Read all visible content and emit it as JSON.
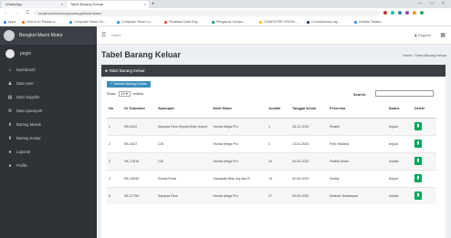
{
  "browser": {
    "tabs": [
      {
        "label": "WhatsApp",
        "close": "×"
      },
      {
        "label": "Tabel Barang Keluar",
        "close": "×"
      }
    ],
    "new_tab": "+",
    "window_controls": "— □ ×",
    "nav": "← → C ⌂",
    "url": "localhost/inventory/barang/keluar/index",
    "extension_colors": [
      "#c0392b",
      "#1abc9c",
      "#2980b9",
      "#8e44ad",
      "#f39c12",
      "#27ae60"
    ],
    "bookmarks": [
      {
        "label": "Apps",
        "color": "#4285f4"
      },
      {
        "label": "How to fix Please w...",
        "color": "#e67e22"
      },
      {
        "label": "Computer Vision Ch...",
        "color": "#3498db"
      },
      {
        "label": "Computer Vision Lo...",
        "color": "#3498db"
      },
      {
        "label": "Pelatihan Data Eng...",
        "color": "#e74c3c"
      },
      {
        "label": "Pengantar Kompu...",
        "color": "#16a085"
      },
      {
        "label": "COMPUTER VISION...",
        "color": "#f1c40f"
      },
      {
        "label": "Convolutional Lay...",
        "color": "#2c3e50"
      },
      {
        "label": "Deteksi Tekstur...",
        "color": "#4285f4"
      }
    ]
  },
  "sidebar": {
    "brand": "Bengkel Murni Motor",
    "user": "pegin",
    "items": [
      {
        "label": "Dashboard",
        "icon": "⌂"
      },
      {
        "label": "Data User",
        "icon": "♟"
      },
      {
        "label": "Data Supplier",
        "icon": "▤"
      },
      {
        "label": "Data Sparepart",
        "icon": "⚙"
      },
      {
        "label": "Barang Masuk",
        "icon": "⬇"
      },
      {
        "label": "Barang Keluar",
        "icon": "⬆"
      },
      {
        "label": "Laporan",
        "icon": "●"
      },
      {
        "label": "Profile",
        "icon": "●"
      }
    ]
  },
  "topbar": {
    "hamburger": "☰",
    "home": "Home",
    "user_menu": "♟ Eugene",
    "grid": "▦"
  },
  "page": {
    "title": "Tabel Barang Keluar",
    "breadcrumb": "Home / Tabel Barang Keluar",
    "box_title": "♣ Tabel Barang Keluar",
    "add_button": "+ Tambah Barang Keluar",
    "show_label_pre": "Show",
    "show_value": "10 ▾",
    "show_label_post": "entries",
    "search_label": "Search:"
  },
  "table": {
    "headers": {
      "no": "No",
      "trx": "ID Transaksi",
      "part": "Sparepart",
      "merk": "Merk Motor",
      "qty": "Jumlah",
      "date": "Tanggal keluar",
      "recv": "Penerima",
      "status": "Status",
      "del": "Delete"
    },
    "rows": [
      {
        "no": "1",
        "trx": "BK-0202",
        "part": "Kampas Rem Depan(Disk) Import",
        "merk": "Honda Mega Pro",
        "qty": "1",
        "date": "28-12-2019",
        "recv": "Rivaldi",
        "status": "terjual"
      },
      {
        "no": "2",
        "trx": "BK-0307",
        "part": "CDI",
        "merk": "Honda Mega Pro",
        "qty": "3",
        "date": "13-01-2020",
        "recv": "Febi Harliana",
        "status": "terjual"
      },
      {
        "no": "3",
        "trx": "BK-17816",
        "part": "CDI",
        "merk": "Honda Mega Pro",
        "qty": "10",
        "date": "04-02-2020",
        "recv": "Padilla Motor",
        "status": "mutasi"
      },
      {
        "no": "4",
        "trx": "BK-23839",
        "part": "Rantai Roda",
        "merk": "Kawasaki Blitz Joy dan R",
        "qty": "14",
        "date": "02-09-2020",
        "recv": "Deddy",
        "status": "terjual"
      },
      {
        "no": "5",
        "trx": "BK-27794",
        "part": "Kampas Rem",
        "merk": "Honda Mega Pro",
        "qty": "27",
        "date": "09-09-2020",
        "recv": "Dimmer Dwiansyah",
        "status": "mutasi"
      }
    ],
    "delete_icon": "▮"
  }
}
